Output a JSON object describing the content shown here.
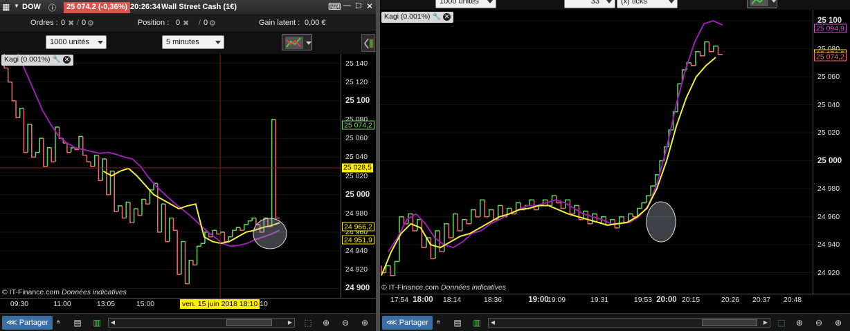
{
  "left": {
    "titlebar": {
      "instrument": "DOW",
      "price_change": "25 074,2 (-0,36%)",
      "time": "20:26:34",
      "name": "Wall Street Cash (1€)"
    },
    "orderbar": {
      "orders_label": "Ordres :",
      "orders_count": "0",
      "orders_pending": "0",
      "position_label": "Position :",
      "position_count": "0",
      "position_pending": "0",
      "gain_label": "Gain latent :",
      "gain_value": "0,00 €"
    },
    "controls": {
      "size": "1000 unités",
      "timeframe": "5 minutes"
    },
    "indicator": {
      "label": "Kagi (0.001%)"
    },
    "credit": {
      "source": "© IT-Finance.com",
      "note": "Données indicatives"
    },
    "price_labels": [
      {
        "text": "25 074,2",
        "color": "#7ee06a",
        "value": 25074.2
      },
      {
        "text": "25 028,5",
        "color": "#ffee00",
        "value": 25028.5,
        "filled": true
      },
      {
        "text": "24 966,2",
        "color": "#ffee00",
        "value": 24966.2
      },
      {
        "text": "24 951,9",
        "color": "#ffee00",
        "value": 24951.9
      }
    ],
    "crosshair_date": "ven. 15 juin 2018 18:10",
    "share_label": "Partager"
  },
  "right": {
    "controls": {
      "size": "1000 unités",
      "ticks_value": "33",
      "ticks_unit": "(x) ticks"
    },
    "indicator": {
      "label": "Kagi (0.001%)"
    },
    "credit": {
      "source": "© IT-Finance.com",
      "note": "Données indicatives"
    },
    "price_labels": [
      {
        "text": "25 094,9",
        "color": "#d055d0",
        "value": 25094.9
      },
      {
        "text": "25 076,5",
        "color": "#ffee00",
        "value": 25076.5
      },
      {
        "text": "25 074,2",
        "color": "#ff6b6b",
        "value": 25074.2
      }
    ],
    "share_label": "Partager"
  },
  "chart_data": [
    {
      "type": "line",
      "title": "DOW - Wall Street Cash (1€) - Kagi (0.001%) - 5 minutes",
      "y_ticks": [
        {
          "label": "25 140",
          "value": 25140,
          "bold": false
        },
        {
          "label": "25 120",
          "value": 25120,
          "bold": false
        },
        {
          "label": "25 100",
          "value": 25100,
          "bold": true
        },
        {
          "label": "25 080",
          "value": 25080,
          "bold": false
        },
        {
          "label": "25 060",
          "value": 25060,
          "bold": false
        },
        {
          "label": "25 040",
          "value": 25040,
          "bold": false
        },
        {
          "label": "25 020",
          "value": 25020,
          "bold": false
        },
        {
          "label": "25 000",
          "value": 25000,
          "bold": true
        },
        {
          "label": "24 980",
          "value": 24980,
          "bold": false
        },
        {
          "label": "24 960",
          "value": 24960,
          "bold": false
        },
        {
          "label": "24 940",
          "value": 24940,
          "bold": false
        },
        {
          "label": "24 920",
          "value": 24920,
          "bold": false
        },
        {
          "label": "24 900",
          "value": 24900,
          "bold": true
        }
      ],
      "x_ticks": [
        {
          "label": "09:30",
          "bold": false
        },
        {
          "label": "11:00",
          "bold": false
        },
        {
          "label": "13:05",
          "bold": false
        },
        {
          "label": "15:00",
          "bold": false
        },
        {
          "label": "10",
          "bold": false
        }
      ],
      "ylim": [
        24890,
        25150
      ],
      "crosshair_value": 25028.5,
      "kagi": [
        25150,
        25135,
        25120,
        25100,
        25082,
        25092,
        25045,
        25075,
        25040,
        25045,
        25060,
        25030,
        25050,
        25035,
        25072,
        25060,
        25055,
        25045,
        25050,
        25048,
        25062,
        25042,
        25035,
        25030,
        25042,
        25015,
        25038,
        25000,
        25025,
        24982,
        24988,
        24975,
        24992,
        24970,
        24985,
        24978,
        24995,
        24990,
        25005,
        25012,
        24960,
        24990,
        24950,
        24975,
        24962,
        24915,
        24950,
        24905,
        24930,
        24925,
        24945,
        24948,
        24960,
        24955,
        24962,
        24958,
        24960,
        24950,
        24955,
        24962,
        24965,
        24962,
        24968,
        24972,
        24975,
        24968,
        24960,
        24975,
        24966,
        25080,
        24975
      ],
      "ma_purple": [
        25150,
        25130,
        25110,
        25090,
        25075,
        25062,
        25055,
        25050,
        25048,
        25046,
        25044,
        25045,
        25043,
        25040,
        25038,
        25030,
        25018,
        25008,
        25000,
        24992,
        24985,
        24978,
        24970,
        24962,
        24955,
        24948,
        24945,
        24946,
        24948,
        24952,
        24955,
        24958,
        24962
      ],
      "ma_yellow": [
        25025,
        25020,
        25025,
        25028,
        25020,
        25010,
        25000,
        24995,
        24990,
        24985,
        24988,
        24990,
        24955,
        24950,
        24948,
        24950,
        24955,
        24960,
        24962,
        24965,
        24967,
        24970
      ]
    },
    {
      "type": "line",
      "title": "Kagi (0.001%) - 33 ticks",
      "y_ticks": [
        {
          "label": "25 100",
          "value": 25100,
          "bold": true
        },
        {
          "label": "25 080",
          "value": 25080,
          "bold": false
        },
        {
          "label": "25 060",
          "value": 25060,
          "bold": false
        },
        {
          "label": "25 040",
          "value": 25040,
          "bold": false
        },
        {
          "label": "25 020",
          "value": 25020,
          "bold": false
        },
        {
          "label": "25 000",
          "value": 25000,
          "bold": true
        },
        {
          "label": "24 980",
          "value": 24980,
          "bold": false
        },
        {
          "label": "24 960",
          "value": 24960,
          "bold": false
        },
        {
          "label": "24 940",
          "value": 24940,
          "bold": false
        },
        {
          "label": "24 920",
          "value": 24920,
          "bold": false
        }
      ],
      "x_ticks": [
        {
          "label": "17:54",
          "bold": false
        },
        {
          "label": "18:00",
          "bold": true
        },
        {
          "label": "18:14",
          "bold": false
        },
        {
          "label": "18:36",
          "bold": false
        },
        {
          "label": "19:00",
          "bold": true
        },
        {
          "label": "19:09",
          "bold": false
        },
        {
          "label": "19:31",
          "bold": false
        },
        {
          "label": "19:53",
          "bold": false
        },
        {
          "label": "20:00",
          "bold": true
        },
        {
          "label": "20:15",
          "bold": false
        },
        {
          "label": "20:26",
          "bold": false
        },
        {
          "label": "20:37",
          "bold": false
        },
        {
          "label": "20:48",
          "bold": false
        }
      ],
      "ylim": [
        24905,
        25108
      ],
      "kagi": [
        24925,
        24920,
        24925,
        24918,
        24928,
        24960,
        24955,
        24962,
        24950,
        24958,
        24938,
        24945,
        24930,
        24950,
        24935,
        24955,
        24945,
        24962,
        24950,
        24958,
        24955,
        24965,
        24960,
        24972,
        24960,
        24965,
        24958,
        24968,
        24960,
        24966,
        24962,
        24970,
        24965,
        24968,
        24972,
        24965,
        24968,
        24972,
        24968,
        24975,
        24970,
        24966,
        24972,
        24962,
        24968,
        24958,
        24964,
        24955,
        24962,
        24956,
        24960,
        24954,
        24958,
        24952,
        24960,
        24956,
        24962,
        24960,
        24966,
        24970,
        24975,
        24982,
        24990,
        25000,
        25010,
        25022,
        25035,
        25055,
        25065,
        25070,
        25068,
        25078,
        25075,
        25085,
        25078,
        25082,
        25076
      ],
      "ma_purple": [
        24935,
        24945,
        24958,
        24962,
        24955,
        24945,
        24940,
        24938,
        24942,
        24948,
        24950,
        24955,
        24958,
        24962,
        24965,
        24968,
        24968,
        24970,
        24972,
        24970,
        24966,
        24962,
        24960,
        24958,
        24955,
        24955,
        24956,
        24960,
        24968,
        24985,
        25010,
        25040,
        25065,
        25085,
        25098,
        25100,
        25097
      ],
      "ma_yellow": [
        24918,
        24935,
        24948,
        24955,
        24952,
        24940,
        24938,
        24942,
        24946,
        24948,
        24952,
        24956,
        24960,
        24962,
        24965,
        24966,
        24968,
        24968,
        24965,
        24962,
        24960,
        24958,
        24956,
        24954,
        24955,
        24956,
        24960,
        24966,
        24980,
        25000,
        25025,
        25045,
        25060,
        25068,
        25074
      ]
    }
  ]
}
